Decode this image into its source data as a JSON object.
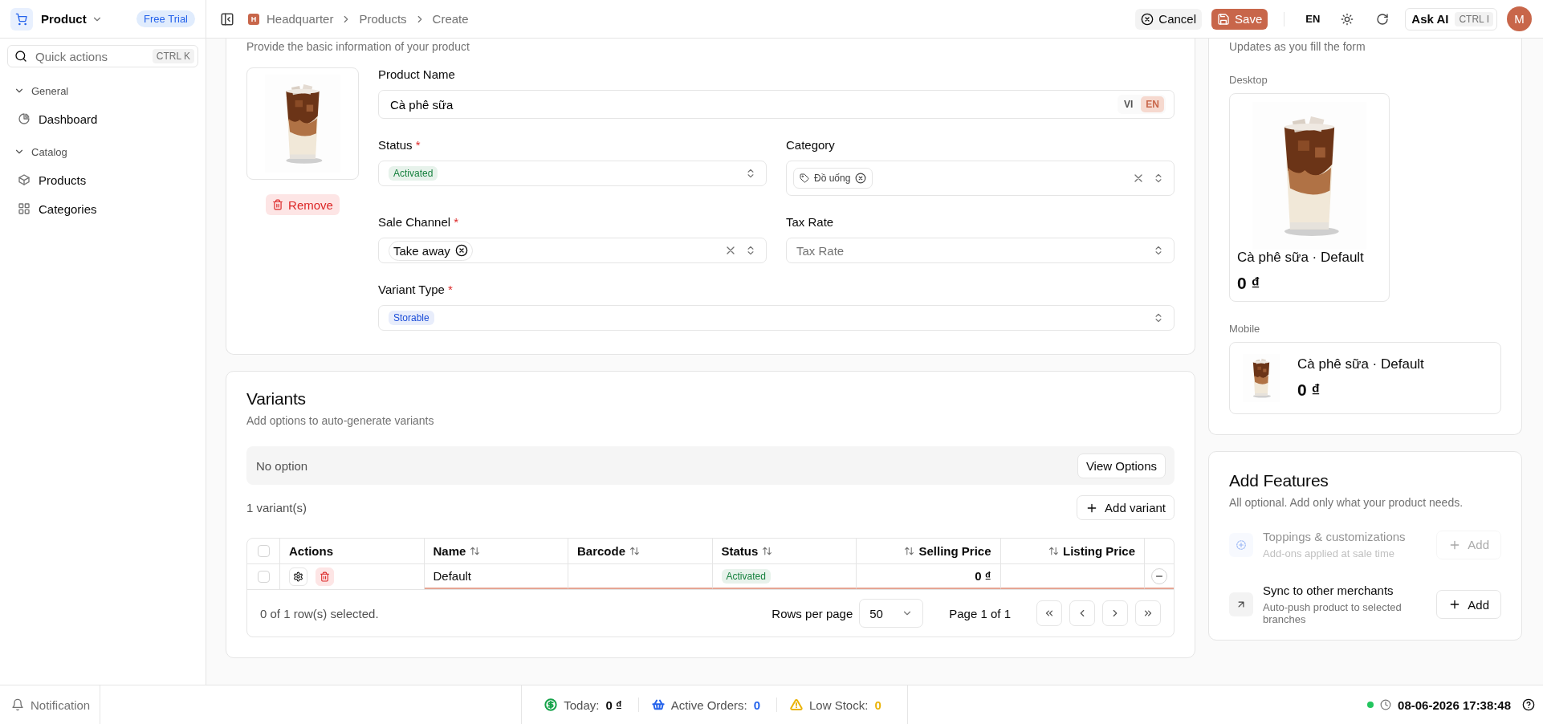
{
  "app": {
    "name": "Product",
    "badge": "Free Trial"
  },
  "quick_actions": {
    "placeholder": "Quick actions",
    "shortcut": "CTRL K"
  },
  "sidebar": {
    "groups": [
      {
        "label": "General",
        "expanded": true,
        "items": [
          {
            "label": "Dashboard",
            "selected": false
          }
        ]
      },
      {
        "label": "Catalog",
        "expanded": true,
        "items": [
          {
            "label": "Products",
            "selected": false
          },
          {
            "label": "Categories",
            "selected": false
          }
        ]
      }
    ]
  },
  "breadcrumb": {
    "badge": "H",
    "items": [
      "Headquarter",
      "Products",
      "Create"
    ]
  },
  "header_actions": {
    "cancel": "Cancel",
    "save": "Save",
    "language": "EN",
    "ask_ai": "Ask AI",
    "ask_ai_shortcut": "CTRL I",
    "avatar": "M"
  },
  "basic_info": {
    "subtitle": "Provide the basic information of your product",
    "remove": "Remove",
    "product_name": {
      "label": "Product Name",
      "value": "Cà phê sữa",
      "languages": [
        {
          "label": "VI",
          "selected": false
        },
        {
          "label": "EN",
          "selected": true
        }
      ]
    },
    "status": {
      "label": "Status",
      "required_mark": "*",
      "value": "Activated",
      "color": "#15803d"
    },
    "category": {
      "label": "Category",
      "chips": [
        "Đồ uống"
      ]
    },
    "sale_channel": {
      "label": "Sale Channel",
      "required_mark": "*",
      "chips": [
        "Take away"
      ]
    },
    "tax_rate": {
      "label": "Tax Rate",
      "placeholder": "Tax Rate"
    },
    "variant_type": {
      "label": "Variant Type",
      "required_mark": "*",
      "value": "Storable",
      "color": "#1d4ed8"
    }
  },
  "variants": {
    "title": "Variants",
    "subtitle": "Add options to auto-generate variants",
    "options_text": "No option",
    "view_options": "View Options",
    "count": "1 variant(s)",
    "add_variant": "Add variant",
    "table": {
      "select_all": {
        "checked": false
      },
      "columns": [
        {
          "label": "Actions",
          "sortable": false,
          "kind": "text"
        },
        {
          "label": "Name",
          "sortable": true,
          "kind": "text"
        },
        {
          "label": "Barcode",
          "sortable": true,
          "kind": "text"
        },
        {
          "label": "Status",
          "sortable": true,
          "kind": "text"
        },
        {
          "label": "Selling Price",
          "sortable": true,
          "kind": "numeric"
        },
        {
          "label": "Listing Price",
          "sortable": true,
          "kind": "numeric"
        }
      ],
      "rows": [
        {
          "checked": false,
          "invalid": true,
          "name": "Default",
          "status": {
            "label": "Activated",
            "color": "#15803d"
          },
          "selling_price": "0 ₫"
        }
      ],
      "selection": "0 of 1 row(s) selected.",
      "rows_per_page_label": "Rows per page",
      "rows_per_page": "50",
      "page": "Page 1 of 1"
    }
  },
  "preview": {
    "subtitle": "Updates as you fill the form",
    "desktop": {
      "label": "Desktop",
      "title": "Cà phê sữa · Default",
      "price": "0 ₫"
    },
    "mobile": {
      "label": "Mobile",
      "title": "Cà phê sữa · Default",
      "price": "0 ₫"
    }
  },
  "features": {
    "title": "Add Features",
    "subtitle": "All optional. Add only what your product needs.",
    "items": [
      {
        "title": "Toppings & customizations",
        "description": "Add-ons applied at sale time",
        "button": "Add",
        "disabled": true
      },
      {
        "title": "Sync to other merchants",
        "description": "Auto-push product to selected branches",
        "button": "Add",
        "disabled": false
      }
    ]
  },
  "status_bar": {
    "notification": "Notification",
    "stats": [
      {
        "label": "Today:",
        "value": "0 ₫",
        "color": "#16a34a",
        "value_tinted": false
      },
      {
        "label": "Active Orders:",
        "value": "0",
        "color": "#2563eb",
        "value_tinted": true
      },
      {
        "label": "Low Stock:",
        "value": "0",
        "color": "#eab308",
        "value_tinted": true
      }
    ],
    "online": true,
    "datetime": "08-06-2026 17:38:48"
  }
}
